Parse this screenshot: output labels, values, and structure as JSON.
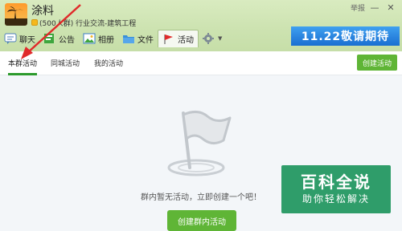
{
  "group": {
    "name": "涂料",
    "level_badge": "5",
    "meta": "(500人群) 行业交流-建筑工程"
  },
  "window": {
    "report_label": "举报",
    "minimize_icon": "minimize-icon",
    "close_icon": "close-icon"
  },
  "tabs": [
    {
      "label": "聊天",
      "icon": "chat-icon"
    },
    {
      "label": "公告",
      "icon": "notice-icon"
    },
    {
      "label": "相册",
      "icon": "album-icon"
    },
    {
      "label": "文件",
      "icon": "folder-icon"
    },
    {
      "label": "活动",
      "icon": "flag-icon",
      "active": true
    },
    {
      "label": "",
      "icon": "gear-icon"
    }
  ],
  "promo": {
    "text": "11.22敬请期待"
  },
  "subnav": {
    "tabs": [
      "本群活动",
      "同城活动",
      "我的活动"
    ],
    "active": 0,
    "create_label": "创建活动"
  },
  "empty": {
    "message": "群内暂无活动，立即创建一个吧！",
    "create_label": "创建群内活动"
  },
  "watermark": {
    "title": "百科全说",
    "subtitle": "助你轻松解决"
  },
  "colors": {
    "accent_green": "#5fb536",
    "tab_green": "#2c9a2c",
    "header_bg": "#d1e6b6",
    "promo_blue": "#1a6fd1",
    "watermark_green": "#2f9d6a",
    "arrow_red": "#e02a2a"
  }
}
